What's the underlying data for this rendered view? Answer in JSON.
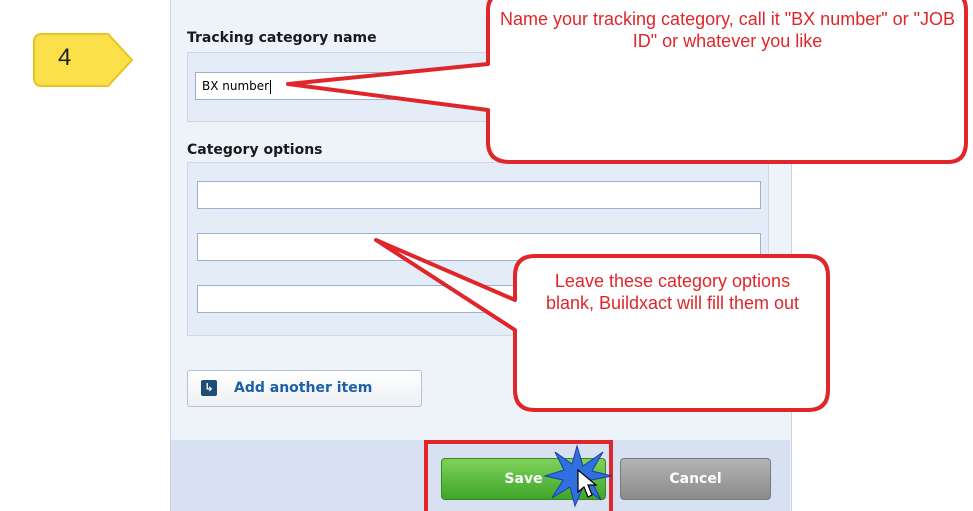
{
  "step": {
    "number": "4",
    "color": "#fbe04a"
  },
  "form": {
    "tracking_label": "Tracking category name",
    "tracking_value": "BX number",
    "options_label": "Category options",
    "options": [
      "",
      "",
      ""
    ],
    "add_item_label": "Add another item",
    "save_label": "Save",
    "cancel_label": "Cancel"
  },
  "callouts": {
    "name_tip": "Name your tracking category, call it \"BX number\" or \"JOB ID\" or whatever you like",
    "options_tip": "Leave these category options blank, Buildxact will fill them out"
  },
  "colors": {
    "callout_border": "#e0262a",
    "callout_text": "#e0262a",
    "save": "#4caf33",
    "cancel": "#9a9a9a",
    "highlight": "#e0262a"
  },
  "icons": {
    "add_item": "add-item-icon",
    "cursor": "mouse-pointer-icon",
    "click": "click-burst-icon"
  }
}
